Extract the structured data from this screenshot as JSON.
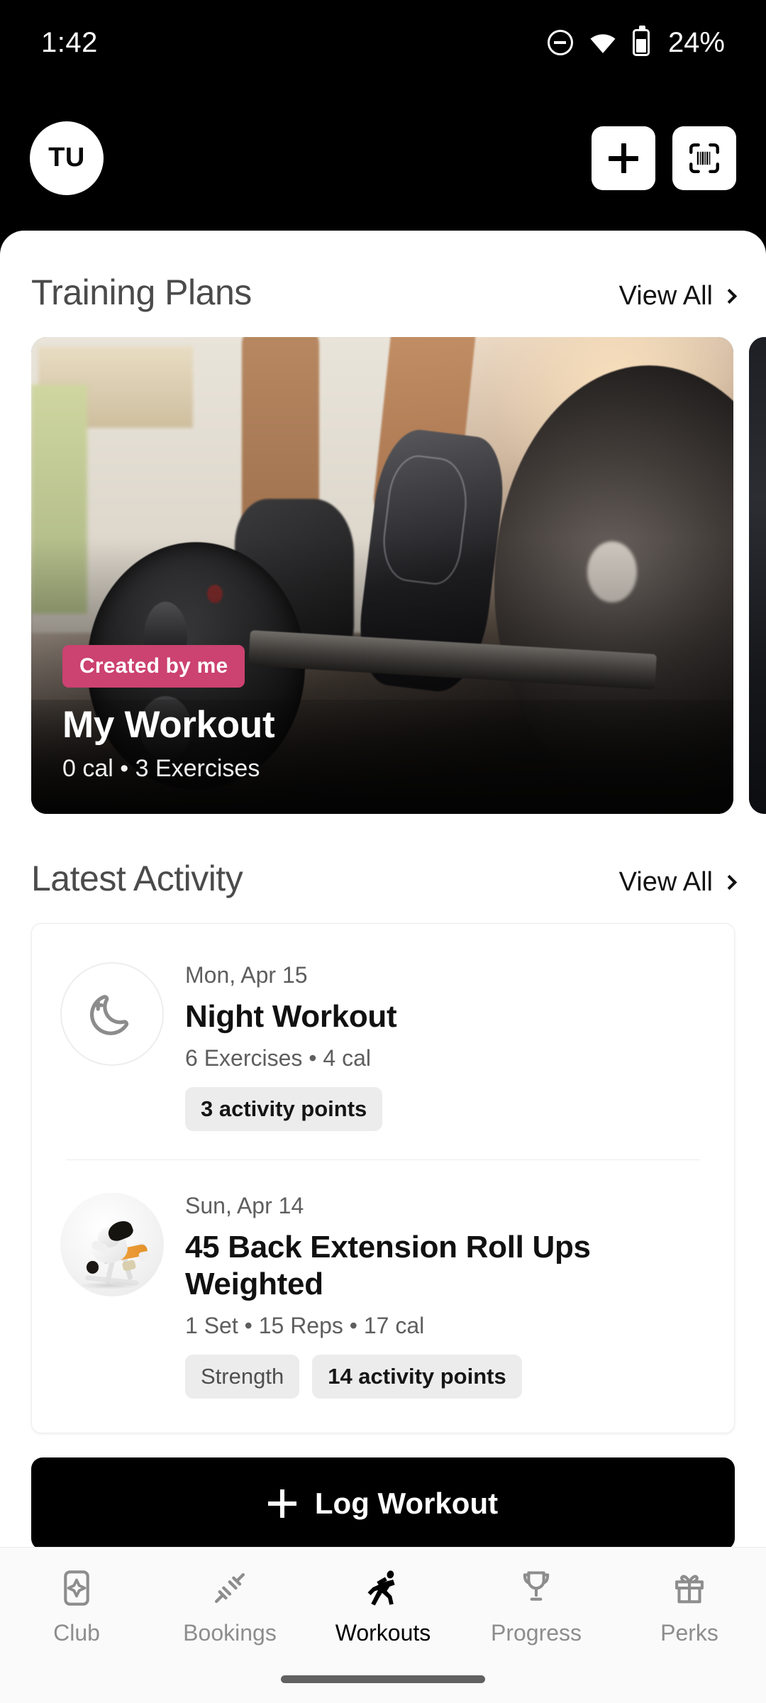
{
  "status_bar": {
    "time": "1:42",
    "battery_percent": "24%",
    "icons": [
      "dnd-icon",
      "wifi-icon",
      "battery-icon"
    ]
  },
  "app_bar": {
    "avatar_initials": "TU",
    "add_button_label": "+",
    "scan_button_label": "scan"
  },
  "training_plans": {
    "section_title": "Training Plans",
    "view_all_label": "View All",
    "cards": [
      {
        "badge": "Created by me",
        "title": "My Workout",
        "meta": "0 cal • 3 Exercises"
      }
    ]
  },
  "latest_activity": {
    "section_title": "Latest Activity",
    "view_all_label": "View All",
    "items": [
      {
        "date": "Mon, Apr 15",
        "title": "Night Workout",
        "subtitle": "6 Exercises • 4 cal",
        "icon": "moon-icon",
        "chips": [
          "3 activity points"
        ]
      },
      {
        "date": "Sun, Apr 14",
        "title": "45 Back Extension Roll Ups Weighted",
        "subtitle": "1 Set • 15 Reps  • 17 cal",
        "icon": "back-extension-exercise-image",
        "chips": [
          "Strength",
          "14 activity points"
        ]
      }
    ]
  },
  "log_workout": {
    "label": "Log Workout"
  },
  "bottom_nav": {
    "active": "Workouts",
    "items": [
      {
        "label": "Club",
        "icon": "club-card-icon"
      },
      {
        "label": "Bookings",
        "icon": "dumbbell-icon"
      },
      {
        "label": "Workouts",
        "icon": "running-person-icon"
      },
      {
        "label": "Progress",
        "icon": "trophy-icon"
      },
      {
        "label": "Perks",
        "icon": "gift-icon"
      }
    ]
  },
  "colors": {
    "accent_pink": "#cc4271",
    "header_bg": "#000000",
    "sheet_bg": "#ffffff",
    "chip_bg": "#ececed",
    "nav_bg": "#fafafa"
  }
}
